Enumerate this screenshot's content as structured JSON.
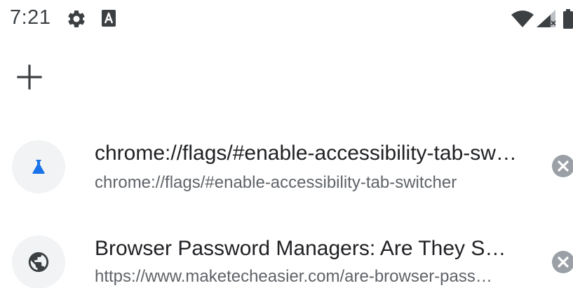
{
  "status_bar": {
    "time": "7:21",
    "icons": [
      "gear-icon",
      "a-notification-icon",
      "wifi-icon",
      "cell-signal-icon",
      "battery-icon"
    ]
  },
  "new_tab": {
    "icon": "plus-icon"
  },
  "tabs": [
    {
      "title": "chrome://flags/#enable-accessibility-tab-switcher",
      "url": "chrome://flags/#enable-accessibility-tab-switcher",
      "favicon": "flask-icon",
      "favicon_color": "#1a73e8"
    },
    {
      "title": "Browser Password Managers: Are They Safe to Use?",
      "url": "https://www.maketecheasier.com/are-browser-password-managers-safe/",
      "favicon": "globe-icon",
      "favicon_color": "#3c4043"
    }
  ],
  "colors": {
    "icon_dark": "#3c4043",
    "close_gray": "#9aa0a6",
    "favicon_bg": "#f1f3f4"
  }
}
